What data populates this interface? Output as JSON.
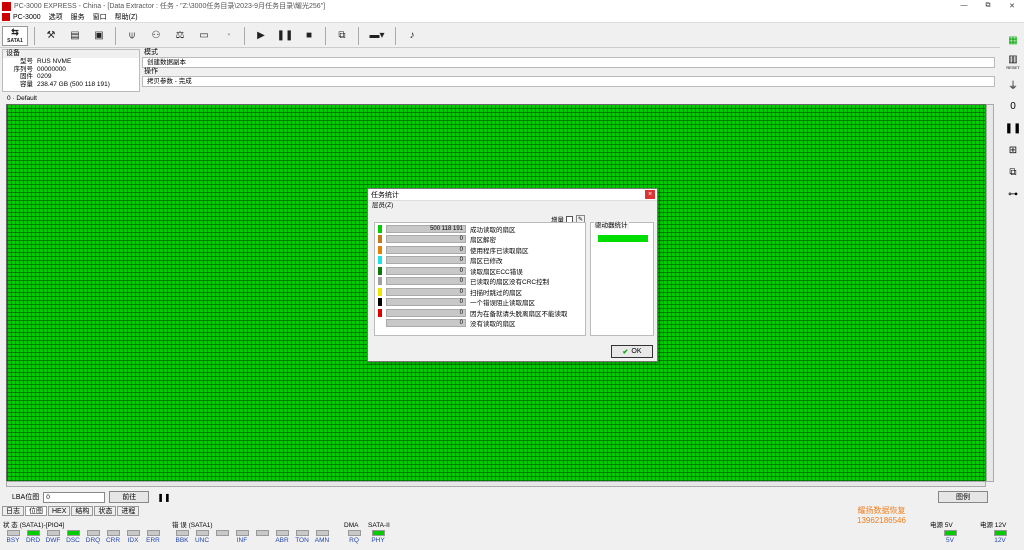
{
  "window": {
    "title": "PC-3000 EXPRESS - China - [Data Extractor : 任务 - \"Z:\\3000任务目录\\2023-9月任务目录\\耀光256\"]",
    "controls": [
      "—",
      "⧉",
      "✕"
    ]
  },
  "menu": {
    "app": "PC-3000",
    "items": [
      "选项",
      "服务",
      "窗口",
      "帮助(Z)"
    ]
  },
  "toolbar": {
    "sata_label": "SATA1",
    "icons": [
      "tools-icon",
      "disk-icon",
      "chip-icon",
      "usb-icon",
      "binoculars-icon",
      "balance-icon",
      "drive-icon",
      "camera-icon",
      "play-icon",
      "pause-icon",
      "stop-icon",
      "copy-icon",
      "terminal-icon",
      "music-icon"
    ]
  },
  "device": {
    "header": "设备",
    "rows": [
      {
        "k": "型号",
        "v": "RUS NVME"
      },
      {
        "k": "序列号",
        "v": "00000000"
      },
      {
        "k": "固件",
        "v": "0209"
      },
      {
        "k": "容量",
        "v": "238.47 GB (500 118 191)"
      }
    ]
  },
  "mode": {
    "header": "模式",
    "value": "创建数据副本",
    "op_header": "操作",
    "op_value": "拷贝参数 - 完成"
  },
  "map": {
    "label": "0 · Default"
  },
  "lba": {
    "label": "LBA位图",
    "value": "0",
    "goto": "前往",
    "legend": "图例"
  },
  "tabs": [
    "日志",
    "位图",
    "HEX",
    "结构",
    "状态",
    "进程"
  ],
  "status": {
    "g1": {
      "title": "状 态 (SATA1)-[PIO4]",
      "leds": [
        {
          "n": "BSY",
          "on": false
        },
        {
          "n": "DRD",
          "on": true
        },
        {
          "n": "DWF",
          "on": false
        },
        {
          "n": "DSC",
          "on": true
        },
        {
          "n": "DRQ",
          "on": false
        },
        {
          "n": "CRR",
          "on": false
        },
        {
          "n": "IDX",
          "on": false
        },
        {
          "n": "ERR",
          "on": false
        }
      ]
    },
    "g2": {
      "title": "错 误 (SATA1)",
      "leds": [
        {
          "n": "BBK",
          "on": false
        },
        {
          "n": "UNC",
          "on": false
        },
        {
          "n": "",
          "on": false
        },
        {
          "n": "INF",
          "on": false
        },
        {
          "n": "",
          "on": false
        },
        {
          "n": "ABR",
          "on": false
        },
        {
          "n": "TON",
          "on": false
        },
        {
          "n": "AMN",
          "on": false
        }
      ]
    },
    "g3": {
      "title": "DMA",
      "leds": [
        {
          "n": "RQ",
          "on": false
        }
      ]
    },
    "g4": {
      "title": "SATA-II",
      "leds": [
        {
          "n": "PHY",
          "on": true
        }
      ]
    },
    "g5": {
      "title": "电源 5V",
      "leds": [
        {
          "n": "5V",
          "on": true
        }
      ]
    },
    "g6": {
      "title": "电源 12V",
      "leds": [
        {
          "n": "12V",
          "on": true
        }
      ]
    }
  },
  "watermark": {
    "line1": "耀扬数据恢复",
    "line2": "13962186546"
  },
  "dialog": {
    "title": "任务统计",
    "menu": "层员(Z)",
    "granularity": "增量",
    "drive_stats": "驱动器统计",
    "ok": "OK",
    "rows": [
      {
        "color": "#00cc00",
        "value": "500 118 191",
        "label": "成功读取的扇区"
      },
      {
        "color": "#c07a20",
        "value": "0",
        "label": "扇区解密"
      },
      {
        "color": "#e08000",
        "value": "0",
        "label": "使用程序已读取扇区"
      },
      {
        "color": "#20e0e0",
        "value": "0",
        "label": "扇区已修改"
      },
      {
        "color": "#0a7a0a",
        "value": "0",
        "label": "读取扇区ECC错误"
      },
      {
        "color": "#a0a0a0",
        "value": "0",
        "label": "已读取的扇区没有CRC控制"
      },
      {
        "color": "#e8e800",
        "value": "0",
        "label": "扫描时跳过的扇区"
      },
      {
        "color": "#000000",
        "value": "0",
        "label": "一个错误阻止读取扇区"
      },
      {
        "color": "#dd0000",
        "value": "0",
        "label": "因为在备就请头脱离扇区不能读取"
      },
      {
        "color": "#ffffff",
        "value": "0",
        "label": "没有读取的扇区"
      }
    ]
  }
}
